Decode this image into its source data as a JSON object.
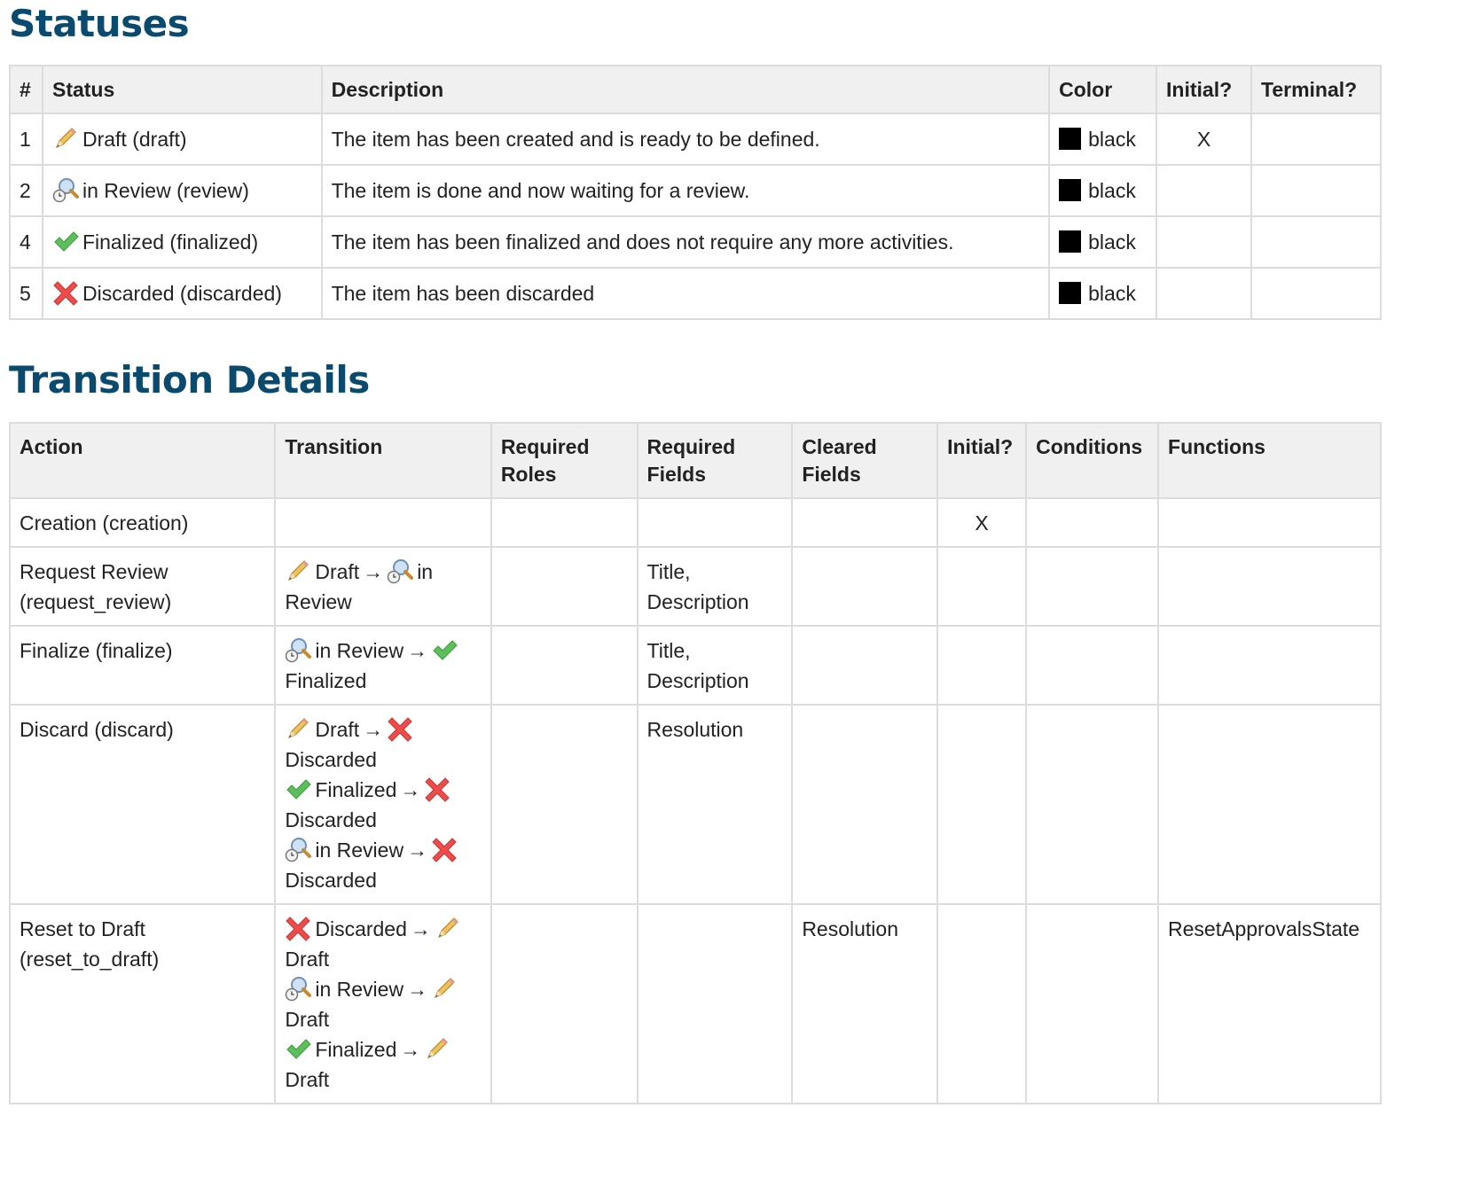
{
  "statuses": {
    "title": "Statuses",
    "headers": [
      "#",
      "Status",
      "Description",
      "Color",
      "Initial?",
      "Terminal?"
    ],
    "rows": [
      {
        "num": "1",
        "icon": "pencil-icon",
        "status": "Draft (draft)",
        "description": "The item has been created and is ready to be defined.",
        "color_name": "black",
        "color_hex": "#000000",
        "initial": "X",
        "terminal": ""
      },
      {
        "num": "2",
        "icon": "review-magnifier-icon",
        "status": "in Review (review)",
        "description": "The item is done and now waiting for a review.",
        "color_name": "black",
        "color_hex": "#000000",
        "initial": "",
        "terminal": ""
      },
      {
        "num": "4",
        "icon": "checkmark-icon",
        "status": "Finalized (finalized)",
        "description": "The item has been finalized and does not require any more activities.",
        "color_name": "black",
        "color_hex": "#000000",
        "initial": "",
        "terminal": ""
      },
      {
        "num": "5",
        "icon": "red-x-icon",
        "status": "Discarded (discarded)",
        "description": "The item has been discarded",
        "color_name": "black",
        "color_hex": "#000000",
        "initial": "",
        "terminal": ""
      }
    ]
  },
  "transitions": {
    "title": "Transition Details",
    "headers": [
      "Action",
      "Transition",
      "Required Roles",
      "Required Fields",
      "Cleared Fields",
      "Initial?",
      "Conditions",
      "Functions"
    ],
    "arrow": "→",
    "rows": [
      {
        "action": "Creation (creation)",
        "transitions": [],
        "required_roles": "",
        "required_fields": "",
        "cleared_fields": "",
        "initial": "X",
        "conditions": "",
        "functions": ""
      },
      {
        "action": "Request Review (request_review)",
        "transitions": [
          {
            "from_icon": "pencil-icon",
            "from": "Draft",
            "to_icon": "review-magnifier-icon",
            "to": "in Review"
          }
        ],
        "required_roles": "",
        "required_fields": "Title, Description",
        "cleared_fields": "",
        "initial": "",
        "conditions": "",
        "functions": ""
      },
      {
        "action": "Finalize (finalize)",
        "transitions": [
          {
            "from_icon": "review-magnifier-icon",
            "from": "in Review",
            "to_icon": "checkmark-icon",
            "to": "Finalized"
          }
        ],
        "required_roles": "",
        "required_fields": "Title, Description",
        "cleared_fields": "",
        "initial": "",
        "conditions": "",
        "functions": ""
      },
      {
        "action": "Discard (discard)",
        "transitions": [
          {
            "from_icon": "pencil-icon",
            "from": "Draft",
            "to_icon": "red-x-icon",
            "to": "Discarded"
          },
          {
            "from_icon": "checkmark-icon",
            "from": "Finalized",
            "to_icon": "red-x-icon",
            "to": "Discarded"
          },
          {
            "from_icon": "review-magnifier-icon",
            "from": "in Review",
            "to_icon": "red-x-icon",
            "to": "Discarded"
          }
        ],
        "required_roles": "",
        "required_fields": "Resolution",
        "cleared_fields": "",
        "initial": "",
        "conditions": "",
        "functions": ""
      },
      {
        "action": "Reset to Draft (reset_to_draft)",
        "transitions": [
          {
            "from_icon": "red-x-icon",
            "from": "Discarded",
            "to_icon": "pencil-icon",
            "to": "Draft"
          },
          {
            "from_icon": "review-magnifier-icon",
            "from": "in Review",
            "to_icon": "pencil-icon",
            "to": "Draft"
          },
          {
            "from_icon": "checkmark-icon",
            "from": "Finalized",
            "to_icon": "pencil-icon",
            "to": "Draft"
          }
        ],
        "required_roles": "",
        "required_fields": "",
        "cleared_fields": "Resolution",
        "initial": "",
        "conditions": "",
        "functions": "ResetApprovalsState"
      }
    ]
  }
}
